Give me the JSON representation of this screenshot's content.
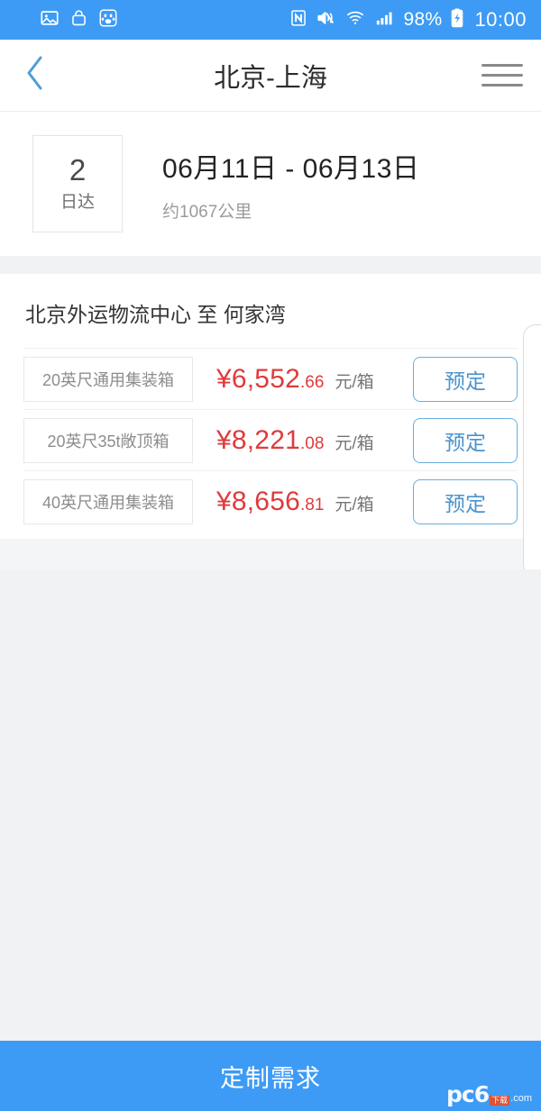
{
  "status_bar": {
    "left_icons": [
      "image-icon",
      "lock-bag-icon",
      "paw-icon"
    ],
    "right_icons": [
      "nfc-icon",
      "mute-icon",
      "wifi-icon",
      "signal-icon"
    ],
    "battery_percent": "98%",
    "battery_icon": "battery-charging-icon",
    "time": "10:00",
    "background": "#3d9bf5"
  },
  "navbar": {
    "back_icon": "chevron-left-icon",
    "title": "北京-上海",
    "menu_icon": "hamburger-menu-icon"
  },
  "summary": {
    "days_number": "2",
    "days_label": "日达",
    "date_range": "06月11日 - 06月13日",
    "distance": "约1067公里"
  },
  "route": {
    "text": "北京外运物流中心  至  何家湾"
  },
  "rows": [
    {
      "container_type": "20英尺通用集装箱",
      "price_main": "¥6,552",
      "price_decimal": ".66",
      "price_unit": "元/箱",
      "book_label": "预定"
    },
    {
      "container_type": "20英尺35t敞顶箱",
      "price_main": "¥8,221",
      "price_decimal": ".08",
      "price_unit": "元/箱",
      "book_label": "预定"
    },
    {
      "container_type": "40英尺通用集装箱",
      "price_main": "¥8,656",
      "price_decimal": ".81",
      "price_unit": "元/箱",
      "book_label": "预定"
    }
  ],
  "bottom_bar": {
    "label": "定制需求",
    "background": "#3d9bf5"
  },
  "watermark": {
    "name": "pc6",
    "badge": "下载",
    "suffix": ".com"
  },
  "colors": {
    "brand_blue": "#3d9bf5",
    "price_red": "#df3b3b",
    "button_blue": "#4b93cd",
    "page_gray": "#f1f2f3"
  }
}
